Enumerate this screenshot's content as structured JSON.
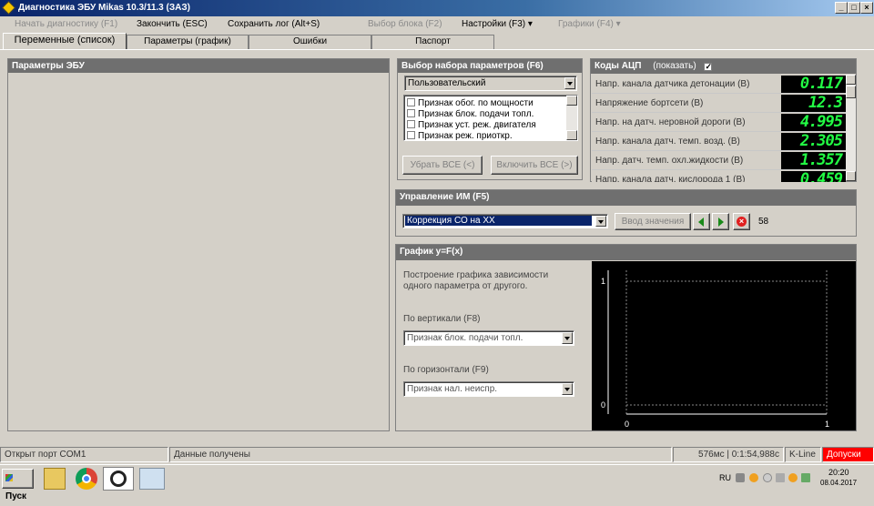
{
  "window": {
    "title": "Диагностика ЭБУ Mikas 10.3/11.3 (ЗАЗ)",
    "controls": [
      "_",
      "□",
      "×"
    ]
  },
  "menu": [
    {
      "label": "Начать диагностику (F1)",
      "disabled": true
    },
    {
      "label": "Закончить (ESC)",
      "disabled": false
    },
    {
      "label": "Сохранить лог (Alt+S)",
      "disabled": false
    },
    {
      "label": "Выбор блока (F2)",
      "disabled": true
    },
    {
      "label": "Настройки (F3) ▾",
      "disabled": false
    },
    {
      "label": "Графики (F4) ▾",
      "disabled": true
    }
  ],
  "tabs": [
    "Переменные (список)",
    "Параметры (график)",
    "Ошибки",
    "Паспорт"
  ],
  "ecu_panel": {
    "title": "Параметры ЭБУ"
  },
  "param_set": {
    "title": "Выбор набора параметров (F6)",
    "selected": "Пользовательский",
    "items": [
      "Признак обог. по мощности",
      "Признак блок. подачи топл.",
      "Признак уст. реж. двигателя",
      "Признак реж. приоткр."
    ],
    "remove_all": "Убрать ВСЕ (<)",
    "include_all": "Включить ВСЕ (>)"
  },
  "adc": {
    "title": "Коды АЦП",
    "show_label": "(показать)",
    "show_checked": true,
    "rows": [
      {
        "label": "Напр. канала датчика детонации (В)",
        "value": "0.117"
      },
      {
        "label": "Напряжение бортсети (В)",
        "value": "12.3"
      },
      {
        "label": "Напр. на датч. неровной дороги (В)",
        "value": "4.995"
      },
      {
        "label": "Напр. канала датч. темп. возд. (В)",
        "value": "2.305"
      },
      {
        "label": "Напр. датч. темп. охл.жидкости (В)",
        "value": "1.357"
      },
      {
        "label": "Напр. канала датч. кислорода 1 (В)",
        "value": "0.459"
      }
    ]
  },
  "im_control": {
    "title": "Управление ИМ (F5)",
    "selected": "Коррекция СО на ХХ",
    "enter_value": "Ввод значения",
    "value": "58"
  },
  "graph": {
    "title": "График y=F(x)",
    "description": "Построение графика зависимости одного параметра от другого.",
    "vertical_label": "По вертикали (F8)",
    "vertical_value": "Признак блок. подачи топл.",
    "horizontal_label": "По горизонтали (F9)",
    "horizontal_value": "Признак нал. неиспр.",
    "y_ticks": [
      "1",
      "0"
    ],
    "x_ticks": [
      "0",
      "1"
    ]
  },
  "status": {
    "port": "Открыт порт COM1",
    "data": "Данные получены",
    "timing": "576мс | 0:1:54,988с",
    "line": "K-Line",
    "alert": "Допуски"
  },
  "taskbar": {
    "start": "Пуск",
    "lang": "RU",
    "time": "20:20",
    "date": "08.04.2017"
  },
  "colors": {
    "title_bg": "#0a246a",
    "panel_head": "#6f6f6f",
    "adc_digits": "#22ff44",
    "alert_bg": "#ff0000",
    "combo_selected": "#0a246a"
  }
}
